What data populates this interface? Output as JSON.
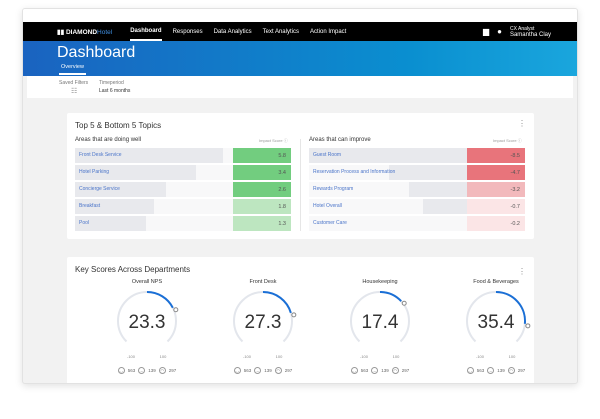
{
  "nav": {
    "brand_bold": "DIAMOND",
    "brand_light": "Hotel",
    "items": [
      "Dashboard",
      "Responses",
      "Data Analytics",
      "Text Analytics",
      "Action Impact"
    ],
    "active": "Dashboard",
    "user_role": "CX Analyst",
    "user_name": "Samantha Clay",
    "icons": [
      "document-icon",
      "user-icon"
    ]
  },
  "header": {
    "title": "Dashboard",
    "tab": "Overview"
  },
  "filters": {
    "saved_label": "Saved Filters",
    "timeperiod_label": "Timeperiod",
    "timeperiod_value": "Last 6 months"
  },
  "topics": {
    "title": "Top 5 & Bottom 5 Topics",
    "impact_label": "Impact Score",
    "good": {
      "title": "Areas that are doing well",
      "items": [
        {
          "label": "Front Desk Service",
          "score": "5.8",
          "color": "#72cd7f"
        },
        {
          "label": "Hotel Parking",
          "score": "3.4",
          "color": "#72cd7f"
        },
        {
          "label": "Concierge Service",
          "score": "2.6",
          "color": "#72cd7f"
        },
        {
          "label": "Breakfast",
          "score": "1.8",
          "color": "#bde6c0"
        },
        {
          "label": "Pool",
          "score": "1.3",
          "color": "#bde6c0"
        }
      ]
    },
    "bad": {
      "title": "Areas that can improve",
      "items": [
        {
          "label": "Guest Room",
          "score": "-8.5",
          "color": "#e8747b"
        },
        {
          "label": "Reservation Process and Information",
          "score": "-4.7",
          "color": "#e8747b"
        },
        {
          "label": "Rewards Program",
          "score": "-3.2",
          "color": "#f2b9bc"
        },
        {
          "label": "Hotel Overall",
          "score": "-0.7",
          "color": "#fbe5e6"
        },
        {
          "label": "Customer Care",
          "score": "-0.2",
          "color": "#fbe5e6"
        }
      ]
    }
  },
  "scores": {
    "title": "Key Scores Across Departments",
    "min_label": "-100",
    "max_label": "100",
    "accent": "#1a6fd6",
    "gauges": [
      {
        "name": "Overall NPS",
        "value": "23.3",
        "promoters": "563",
        "passives": "139",
        "detractors": "297"
      },
      {
        "name": "Front Desk",
        "value": "27.3",
        "promoters": "563",
        "passives": "139",
        "detractors": "297"
      },
      {
        "name": "Housekeeping",
        "value": "17.4",
        "promoters": "563",
        "passives": "139",
        "detractors": "297"
      },
      {
        "name": "Food & Beverages",
        "value": "35.4",
        "promoters": "563",
        "passives": "139",
        "detractors": "297"
      }
    ]
  }
}
